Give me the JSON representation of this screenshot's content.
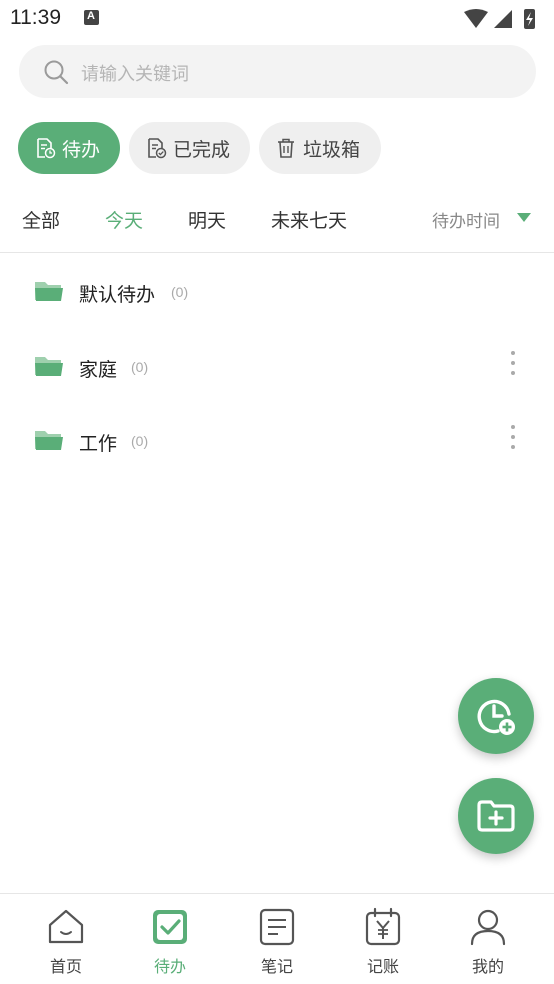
{
  "status_bar": {
    "time": "11:39",
    "notification_badge": "A"
  },
  "search": {
    "placeholder": "请输入关键词",
    "icon": "search-icon"
  },
  "chips": [
    {
      "label": "待办",
      "icon": "todo-doc-icon",
      "active": true
    },
    {
      "label": "已完成",
      "icon": "done-doc-icon",
      "active": false
    },
    {
      "label": "垃圾箱",
      "icon": "trash-icon",
      "active": false
    }
  ],
  "filters": {
    "tabs": [
      {
        "label": "全部",
        "active": false
      },
      {
        "label": "今天",
        "active": true
      },
      {
        "label": "明天",
        "active": false
      },
      {
        "label": "未来七天",
        "active": false
      }
    ],
    "sort_label": "待办时间"
  },
  "folders": [
    {
      "name": "默认待办",
      "count": "(0)",
      "has_menu": false
    },
    {
      "name": "家庭",
      "count": "(0)",
      "has_menu": true
    },
    {
      "name": "工作",
      "count": "(0)",
      "has_menu": true
    }
  ],
  "fabs": {
    "reminder_icon": "clock-add-icon",
    "folder_icon": "folder-add-icon"
  },
  "nav": [
    {
      "label": "首页",
      "icon": "home-icon",
      "active": false
    },
    {
      "label": "待办",
      "icon": "todo-check-icon",
      "active": true
    },
    {
      "label": "笔记",
      "icon": "note-icon",
      "active": false
    },
    {
      "label": "记账",
      "icon": "ledger-icon",
      "active": false
    },
    {
      "label": "我的",
      "icon": "profile-icon",
      "active": false
    }
  ],
  "colors": {
    "accent": "#5aae78",
    "folder": "#5aae78",
    "muted": "#aaaaaa"
  }
}
